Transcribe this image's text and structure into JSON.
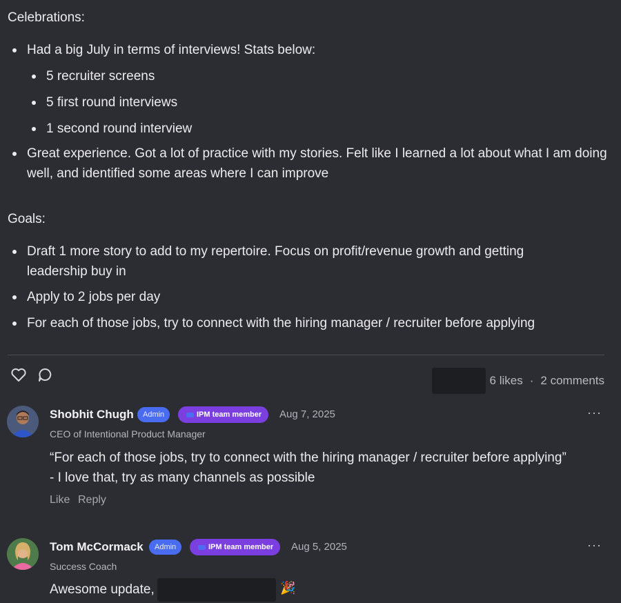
{
  "post": {
    "celebrations_title": "Celebrations:",
    "celebrations": [
      "Had a big July in terms of interviews! Stats below:",
      "Great experience. Got a lot of practice with my stories. Felt like I learned a lot about what I am doing well, and identified some areas where I can improve"
    ],
    "stats": [
      "5  recruiter screens",
      "5 first round interviews",
      "1 second round interview"
    ],
    "goals_title": "Goals:",
    "goals": [
      "Draft 1 more story to add to my repertoire. Focus on profit/revenue growth and getting leadership buy in",
      "Apply to 2 jobs per day",
      "For each of those jobs, try to connect with the hiring manager / recruiter before applying"
    ]
  },
  "reactions": {
    "like_icon": "heart-icon",
    "comment_icon": "speech-bubble-icon",
    "likes": "6 likes",
    "separator": "·",
    "comments": "2 comments"
  },
  "comments": [
    {
      "name": "Shobhit Chugh",
      "admin_badge": "Admin",
      "team_badge": "IPM team member",
      "date": "Aug 7, 2025",
      "subtitle": "CEO of Intentional Product Manager",
      "text": "“For each of those jobs, try to connect with the hiring manager / recruiter before applying” - I love that, try as many channels as possible",
      "like": "Like",
      "reply": "Reply",
      "more": "···"
    },
    {
      "name": "Tom McCormack",
      "admin_badge": "Admin",
      "team_badge": "IPM team member",
      "date": "Aug 5, 2025",
      "subtitle": "Success Coach",
      "text": "Awesome update,",
      "emoji": "🎉",
      "more": "···"
    }
  ],
  "colors": {
    "background": "#2b2d33",
    "admin_badge": "#4a6cf0",
    "team_badge": "#7b3fe0"
  }
}
